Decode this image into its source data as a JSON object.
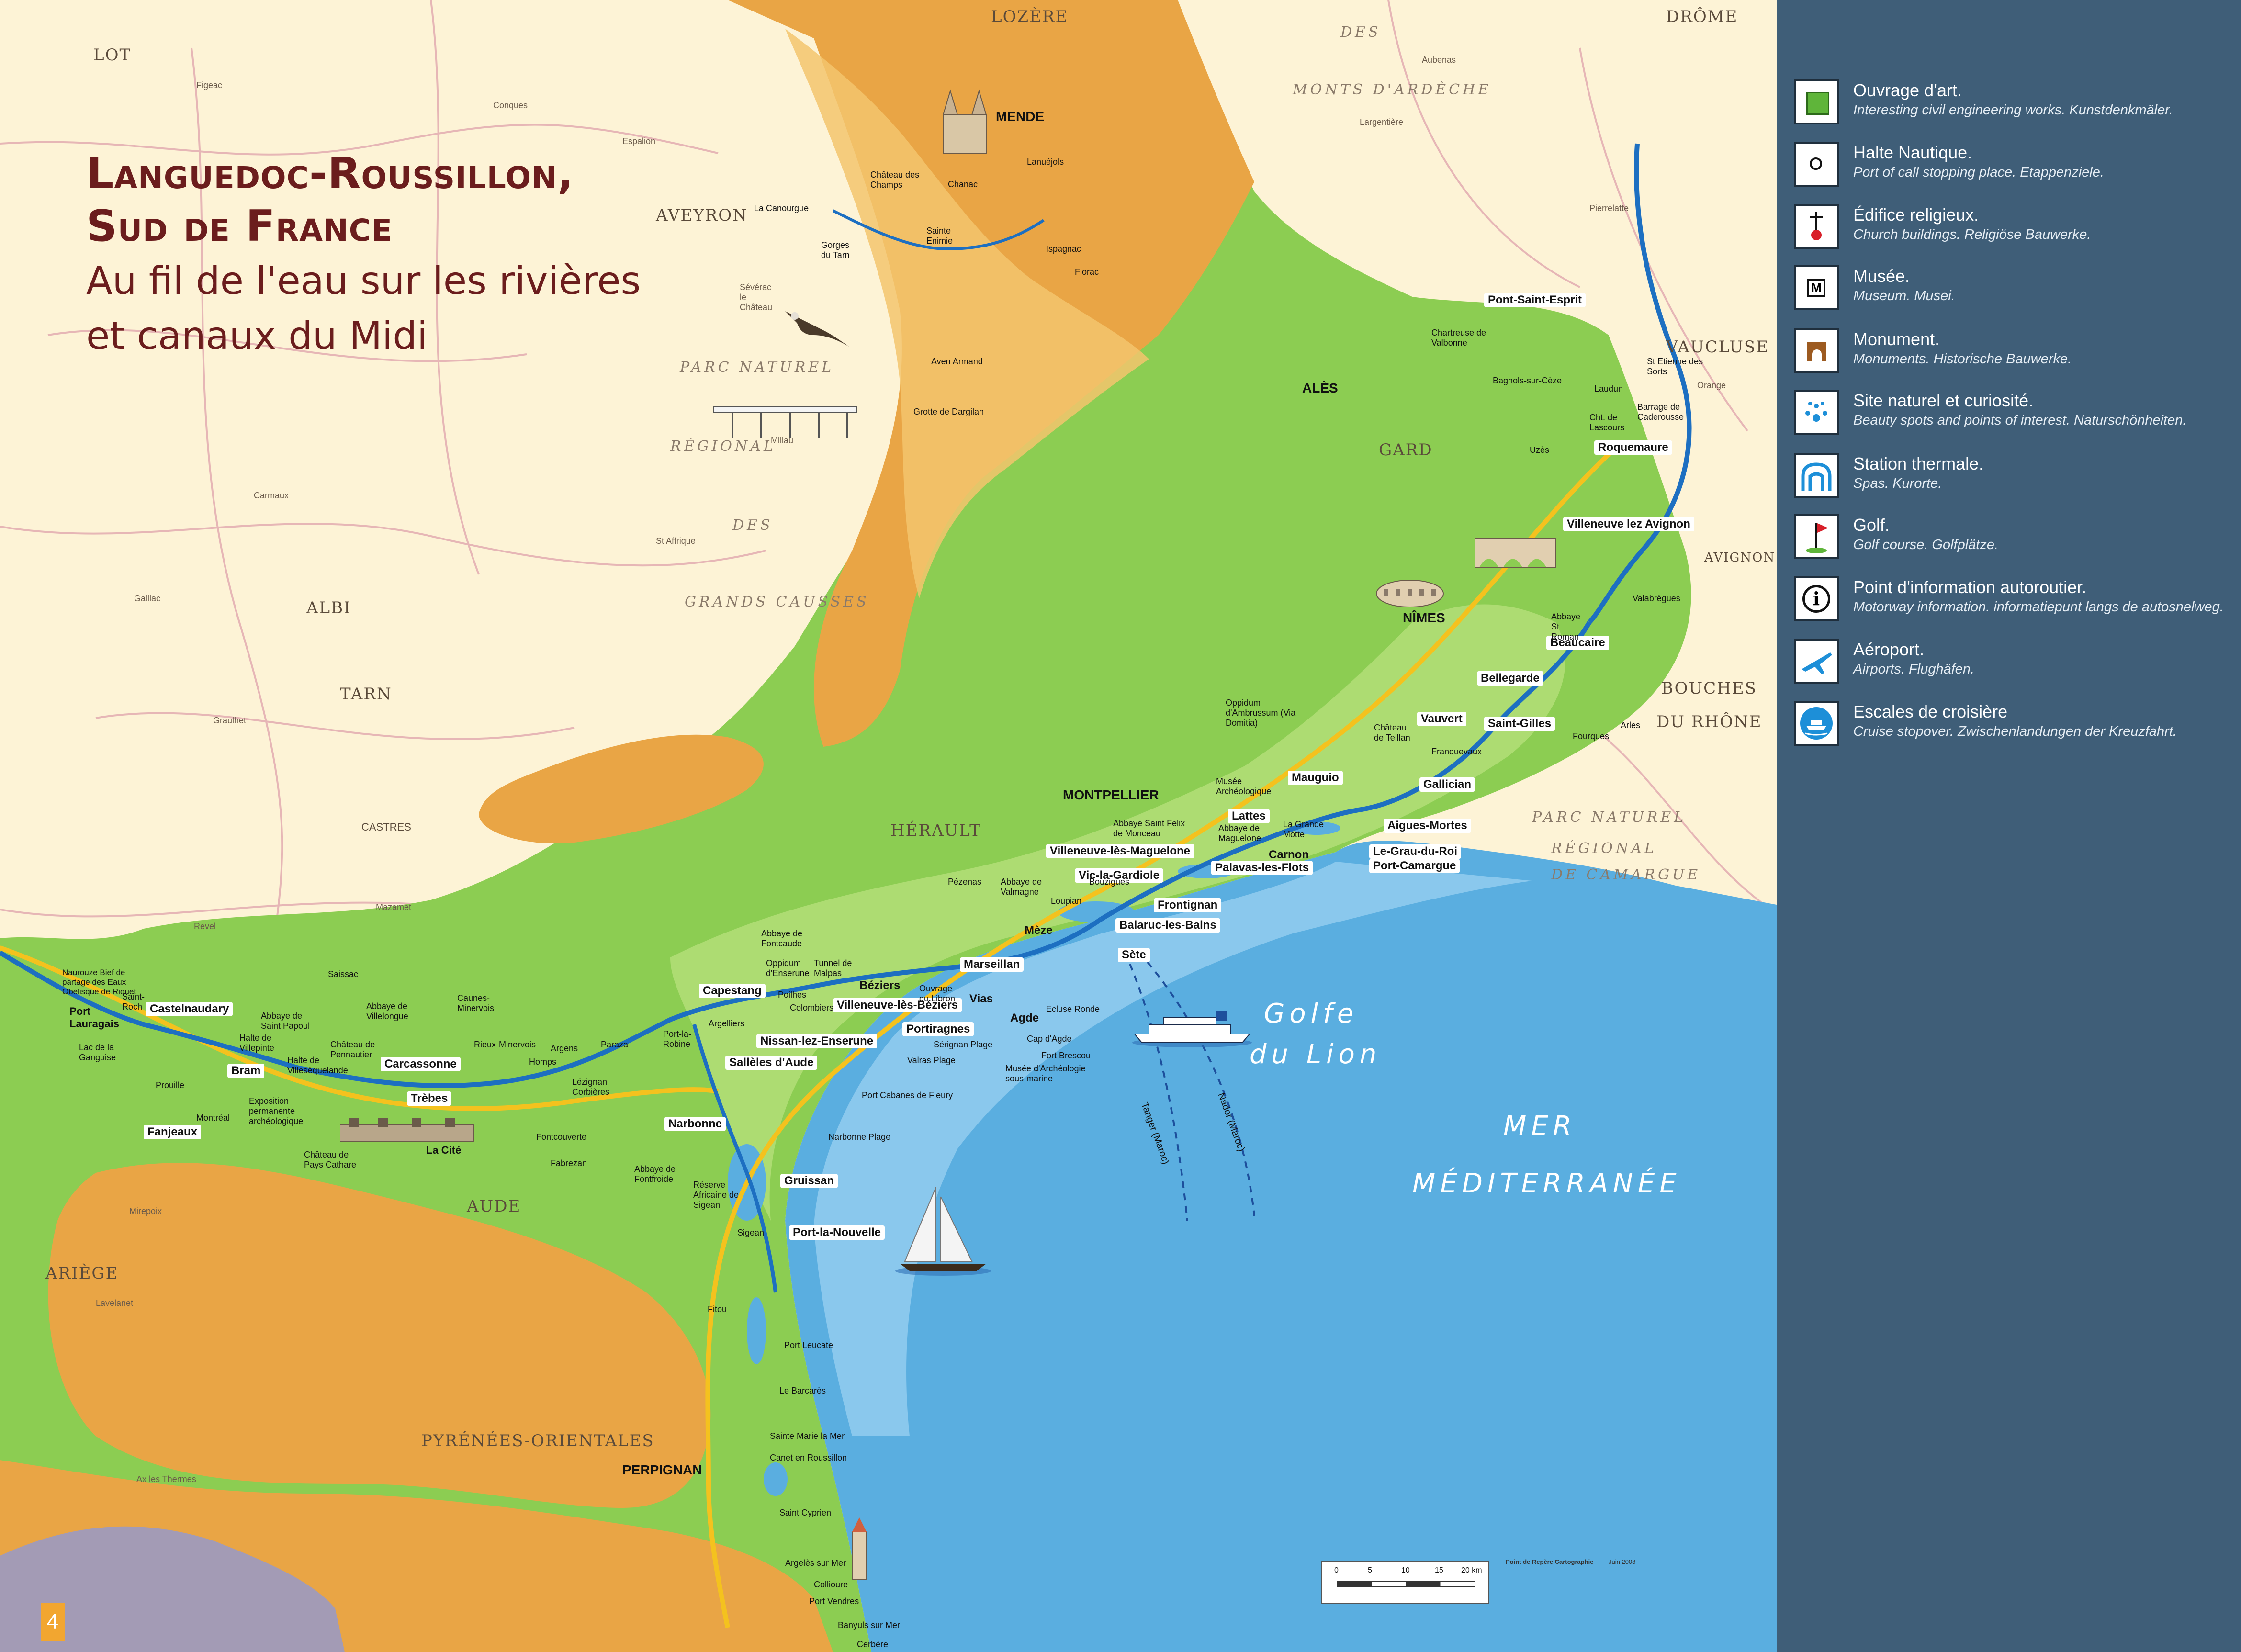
{
  "title": {
    "line1": "Languedoc-Roussillon,",
    "line2": "Sud de France",
    "line3": "Au fil de l'eau sur les rivières",
    "line4": "et canaux du Midi"
  },
  "page_number": "4",
  "colors": {
    "sea": "#5aaee0",
    "plain_green": "#8ccd52",
    "mountain_orange": "#e9a545",
    "outside_cream": "#fdf3d6",
    "legend_bg": "#3f5e78",
    "canal_blue": "#1d6fc1",
    "title_color": "#6b1d1d"
  },
  "legend": [
    {
      "icon": "green-square-icon",
      "title": "Ouvrage d'art.",
      "subtitle": "Interesting civil engineering works. Kunstdenkmäler."
    },
    {
      "icon": "circle-icon",
      "title": "Halte Nautique.",
      "subtitle": "Port of call stopping place. Etappenziele."
    },
    {
      "icon": "cross-icon",
      "title": "Édifice religieux.",
      "subtitle": "Church buildings. Religiöse Bauwerke."
    },
    {
      "icon": "museum-icon",
      "title": "Musée.",
      "subtitle": "Museum. Musei."
    },
    {
      "icon": "castle-icon",
      "title": "Monument.",
      "subtitle": "Monuments. Historische Bauwerke."
    },
    {
      "icon": "natural-site-icon",
      "title": "Site naturel et curiosité.",
      "subtitle": "Beauty spots and points of interest. Naturschönheiten."
    },
    {
      "icon": "spa-icon",
      "title": "Station thermale.",
      "subtitle": "Spas. Kurorte."
    },
    {
      "icon": "golf-flag-icon",
      "title": "Golf.",
      "subtitle": "Golf course. Golfplätze."
    },
    {
      "icon": "info-icon",
      "title": "Point d'information autoroutier.",
      "subtitle": "Motorway information. informatiepunt langs de autosnelweg."
    },
    {
      "icon": "airplane-icon",
      "title": "Aéroport.",
      "subtitle": "Airports. Flughäfen."
    },
    {
      "icon": "cruise-ship-icon",
      "title": "Escales de croisière",
      "subtitle": "Cruise stopover. Zwischenlandungen der Kreuzfahrt."
    }
  ],
  "regions": {
    "lozere": "LOZÈRE",
    "drome": "DRÔME",
    "lot": "LOT",
    "aveyron": "AVEYRON",
    "tarn": "TARN",
    "albi": "ALBI",
    "vaucluse": "VAUCLUSE",
    "avignon": "AVIGNON",
    "gard": "GARD",
    "herault": "HÉRAULT",
    "aude": "AUDE",
    "ariege": "ARIÈGE",
    "pyrenees": "PYRÉNÉES-ORIENTALES",
    "bouches1": "BOUCHES",
    "bouches2": "DU RHÔNE",
    "monts": "MONTS D'ARDÈCHE",
    "des_top": "DES",
    "parc": "PARC NATUREL",
    "regional": "RÉGIONAL",
    "des": "DES",
    "grands": "GRANDS CAUSSES",
    "parc2": "PARC NATUREL",
    "regional2": "RÉGIONAL",
    "camargue": "DE CAMARGUE"
  },
  "sea_labels": {
    "golfe1": "Golfe",
    "golfe2": "du Lion",
    "mer1": "MER",
    "mer2": "MÉDITERRANÉE"
  },
  "big_cities": {
    "mende": "MENDE",
    "ales": "ALÈS",
    "nimes": "NÎMES",
    "montpellier": "MONTPELLIER",
    "perpignan": "PERPIGNAN",
    "castres": "CASTRES"
  },
  "canal_cities": {
    "pont_saint_esprit": "Pont-Saint-Esprit",
    "roquemaure": "Roquemaure",
    "villeneuve_avignon": "Villeneuve lez Avignon",
    "beaucaire": "Beaucaire",
    "bellegarde": "Bellegarde",
    "vauvert": "Vauvert",
    "saint_gilles": "Saint-Gilles",
    "gallician": "Gallician",
    "aigues_mortes": "Aigues-Mortes",
    "grau_du_roi": "Le-Grau-du-Roi",
    "port_camargue": "Port-Camargue",
    "mauguio": "Mauguio",
    "lattes": "Lattes",
    "carnon": "Carnon",
    "palavas": "Palavas-les-Flots",
    "villeneuve_maguelone": "Villeneuve-lès-Maguelone",
    "vic_gardiole": "Vic-la-Gardiole",
    "frontignan": "Frontignan",
    "balaruc": "Balaruc-les-Bains",
    "meze": "Mèze",
    "sete": "Sète",
    "marseillan": "Marseillan",
    "vias": "Vias",
    "agde": "Agde",
    "portiragnes": "Portiragnes",
    "beziers": "Béziers",
    "villeneuve_beziers": "Villeneuve-lès-Béziers",
    "capestang": "Capestang",
    "nissan": "Nissan-lez-Enserune",
    "salleles": "Sallèles d'Aude",
    "narbonne": "Narbonne",
    "gruissan": "Gruissan",
    "port_la_nouvelle": "Port-la-Nouvelle",
    "carcassonne": "Carcassonne",
    "trebes": "Trèbes",
    "castelnaudary": "Castelnaudary",
    "bram": "Bram",
    "fanjeaux": "Fanjeaux",
    "port_lauragais": "Port Lauragais"
  },
  "small_labels": {
    "chateau_champs": "Château des Champs",
    "chanac": "Chanac",
    "lanuejols": "Lanuéjols",
    "la_canourgue": "La Canourgue",
    "gorges_tarn": "Gorges du Tarn",
    "sainte_enimie": "Sainte Enimie",
    "ispagnac": "Ispagnac",
    "florac": "Florac",
    "aven_armand": "Aven Armand",
    "grotte_dargilan": "Grotte de Dargilan",
    "chartreuse": "Chartreuse de Valbonne",
    "bagnols": "Bagnols-sur-Cèze",
    "laudun": "Laudun",
    "lascours": "Cht. de Lascours",
    "uzes": "Uzès",
    "barrage": "Barrage de Caderousse",
    "st_etienne_sorts": "St Etienne des Sorts",
    "valabregues": "Valabrègues",
    "abbaye_st_roman": "Abbaye St Roman",
    "arles": "Arles",
    "fourques": "Fourques",
    "oppidum": "Oppidum d'Ambrussum (Via Domitia)",
    "chateau_teillan": "Château de Teillan",
    "franquevaux": "Franquevaux",
    "musee_arch": "Musée Archéologique",
    "abbaye_felix": "Abbaye Saint Felix de Monceau",
    "abbaye_maguelone": "Abbaye de Maguelone",
    "la_grande_motte": "La Grande Motte",
    "loupian": "Loupian",
    "bouzigues": "Bouzigues",
    "abbaye_valmagne": "Abbaye de Valmagne",
    "pezenas": "Pézenas",
    "abbaye_fontcaude": "Abbaye de Fontcaude",
    "oppidum_enserune": "Oppidum d'Enserune",
    "tunnel_malpas": "Tunnel de Malpas",
    "ouvrage_libron": "Ouvrage du Libron",
    "poilhes": "Poilhes",
    "colombiers": "Colombiers",
    "ecluse_ronde": "Ecluse Ronde",
    "cap_agde": "Cap d'Agde",
    "fort_brescou": "Fort Brescou",
    "musee_sous_marine": "Musée d'Archéologie sous-marine",
    "serignan": "Sérignan Plage",
    "valras": "Valras Plage",
    "cabanes_fleury": "Port Cabanes de Fleury",
    "narbonne_plage": "Narbonne Plage",
    "abbaye_fontfroide": "Abbaye de Fontfroide",
    "reserve_sigean": "Réserve Africaine de Sigean",
    "sigean": "Sigean",
    "fitou": "Fitou",
    "port_leucate": "Port Leucate",
    "barcares": "Le Barcarès",
    "sainte_marie": "Sainte Marie la Mer",
    "canet": "Canet en Roussillon",
    "saint_cyprien": "Saint Cyprien",
    "argeles": "Argelès sur Mer",
    "collioure": "Collioure",
    "port_vendres": "Port Vendres",
    "banyuls": "Banyuls sur Mer",
    "cerbere": "Cerbère",
    "la_cite": "La Cité",
    "chateaux_cathare": "Château de Pays Cathare",
    "exposition": "Exposition permanente archéologique",
    "montreal": "Montréal",
    "prouille": "Prouille",
    "abbaye_villelongue": "Abbaye de Villelongue",
    "abbaye_st_papoul": "Abbaye de Saint Papoul",
    "halte_villepinte": "Halte de Villepinte",
    "halte_villesequelande": "Halte de Villesèquelande",
    "chateau_pennautier": "Château de Pennautier",
    "caunes": "Caunes-Minervois",
    "rieux": "Rieux-Minervois",
    "homps": "Homps",
    "argens": "Argens",
    "paraza": "Paraza",
    "lezignan": "Lézignan Corbières",
    "fabrezan": "Fabrezan",
    "fontcouverte": "Fontcouverte",
    "port_robine": "Port-la-Robine",
    "argelliers": "Argelliers",
    "lac_ganguise": "Lac de la Ganguise",
    "naurouze": "Naurouze Bief de partage des Eaux Obélisque de Riquet",
    "saint_roch": "Saint-Roch",
    "saissac": "Saissac",
    "mazamet": "Mazamet",
    "carmaux": "Carmaux",
    "gaillac": "Gaillac",
    "espalion": "Espalion",
    "conques": "Conques",
    "figeac": "Figeac",
    "millau": "Millau",
    "st_affrique": "St Affrique",
    "severac": "Sévérac le Château",
    "aubenas": "Aubenas",
    "largentiere": "Largentière",
    "pierrelatte": "Pierrelatte",
    "orange": "Orange",
    "lavelanet": "Lavelanet",
    "ax": "Ax les Thermes",
    "mirepoix": "Mirepoix",
    "revel": "Revel",
    "graulhet": "Graulhet"
  },
  "boats": {
    "tanger": "Tanger (Maroc)",
    "nador": "Nador (Maroc)"
  },
  "scale_bar": {
    "ticks": [
      "0",
      "5",
      "10",
      "15",
      "20 km"
    ]
  },
  "credits": {
    "line1": "Point de Repère Cartographie",
    "line2": "Juin 2008"
  }
}
